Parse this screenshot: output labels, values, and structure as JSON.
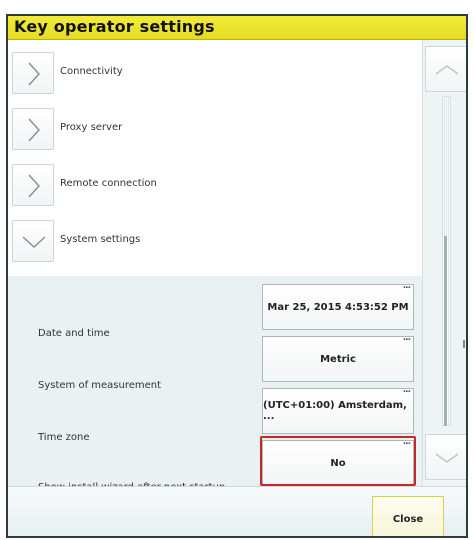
{
  "window": {
    "title": "Key operator settings"
  },
  "nav_items": [
    {
      "label": "Connectivity",
      "expanded": false
    },
    {
      "label": "Proxy server",
      "expanded": false
    },
    {
      "label": "Remote connection",
      "expanded": false
    },
    {
      "label": "System settings",
      "expanded": true
    }
  ],
  "system_settings": [
    {
      "label": "Date and time",
      "value": "Mar 25, 2015 4:53:52 PM"
    },
    {
      "label": "System of measurement",
      "value": "Metric"
    },
    {
      "label": "Time zone",
      "value": "(UTC+01:00) Amsterdam, ..."
    },
    {
      "label": "Show install wizard after next startup",
      "value": "No"
    }
  ],
  "more_indicator": "...",
  "footer": {
    "close_label": "Close"
  },
  "colors": {
    "title_bar": "#e9e12a",
    "highlight_border": "#c62828",
    "panel_background": "#e9f1f2"
  },
  "icons": {
    "collapsed": "chevron-right-icon",
    "expanded": "chevron-down-icon",
    "scroll_up": "chevron-up-icon",
    "scroll_down": "chevron-down-icon"
  }
}
